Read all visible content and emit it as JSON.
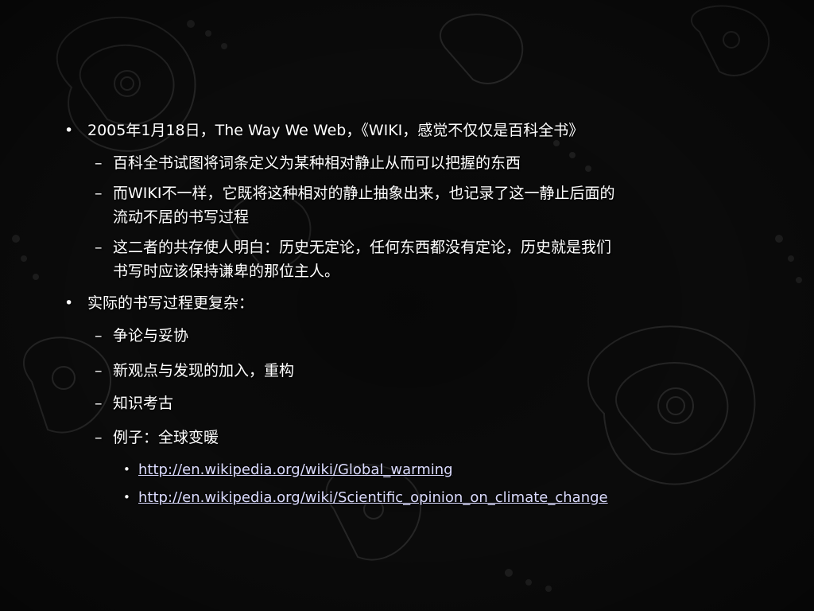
{
  "slide": {
    "bullet_glyph": "•",
    "dash_glyph": "–",
    "items": [
      {
        "text": "2005年1月18日，The Way We Web，《WIKI，感觉不仅仅是百科全书》"
      },
      {
        "text": "百科全书试图将词条定义为某种相对静止从而可以把握的东西"
      },
      {
        "line1": "而WIKI不一样，它既将这种相对的静止抽象出来，也记录了这一静止后面的",
        "line2": "流动不居的书写过程"
      },
      {
        "line1": "这二者的共存使人明白：历史无定论，任何东西都没有定论，历史就是我们",
        "line2": "书写时应该保持谦卑的那位主人。"
      },
      {
        "text": "实际的书写过程更复杂："
      },
      {
        "text": "争论与妥协"
      },
      {
        "text": "新观点与发现的加入，重构"
      },
      {
        "text": "知识考古"
      },
      {
        "text": "例子：全球变暖"
      }
    ],
    "links": [
      {
        "text": "http://en.wikipedia.org/wiki/Global_warming"
      },
      {
        "text": "http://en.wikipedia.org/wiki/Scientific_opinion_on_climate_change"
      }
    ]
  },
  "colors": {
    "background": "#0b0b0b",
    "pattern": "#2a2a2a",
    "text": "#ffffff",
    "link": "#dcdcff"
  }
}
